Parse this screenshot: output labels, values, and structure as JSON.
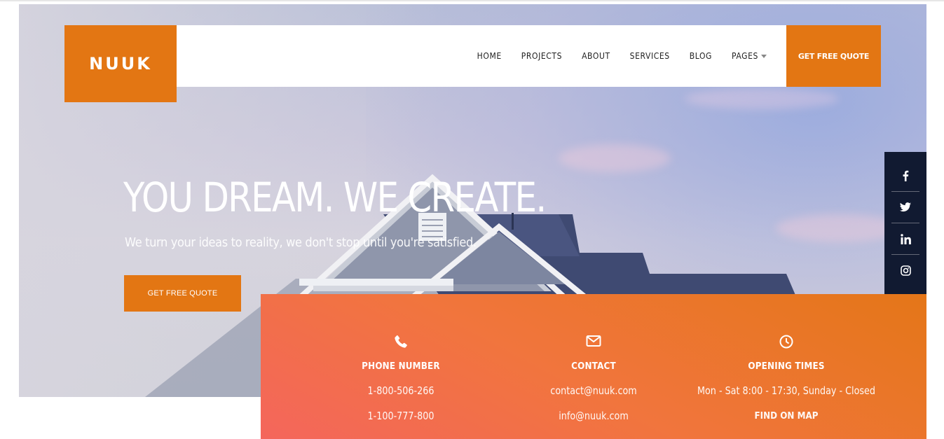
{
  "brand": {
    "logo": "NUUK",
    "accent": "#e37613",
    "dark": "#111a31"
  },
  "nav": {
    "items": [
      {
        "label": "HOME"
      },
      {
        "label": "PROJECTS"
      },
      {
        "label": "ABOUT"
      },
      {
        "label": "SERVICES"
      },
      {
        "label": "BLOG"
      },
      {
        "label": "PAGES",
        "dropdown": true
      }
    ],
    "cta": "GET FREE QUOTE"
  },
  "hero": {
    "title": "YOU DREAM. WE CREATE.",
    "subtitle": "We turn your ideas to reality, we don't stop until you're satisfied.",
    "cta": "GET FREE QUOTE"
  },
  "social": [
    {
      "icon": "facebook-icon"
    },
    {
      "icon": "twitter-icon"
    },
    {
      "icon": "linkedin-icon"
    },
    {
      "icon": "instagram-icon"
    }
  ],
  "info": {
    "phone": {
      "icon": "phone-icon",
      "title": "PHONE NUMBER",
      "lines": [
        "1-800-506-266",
        "1-100-777-800"
      ]
    },
    "contact": {
      "icon": "envelope-icon",
      "title": "CONTACT",
      "lines": [
        "contact@nuuk.com",
        "info@nuuk.com"
      ]
    },
    "hours": {
      "icon": "clock-icon",
      "title": "OPENING TIMES",
      "lines": [
        "Mon - Sat 8:00 - 17:30, Sunday - Closed"
      ],
      "link": "FIND ON MAP"
    }
  }
}
